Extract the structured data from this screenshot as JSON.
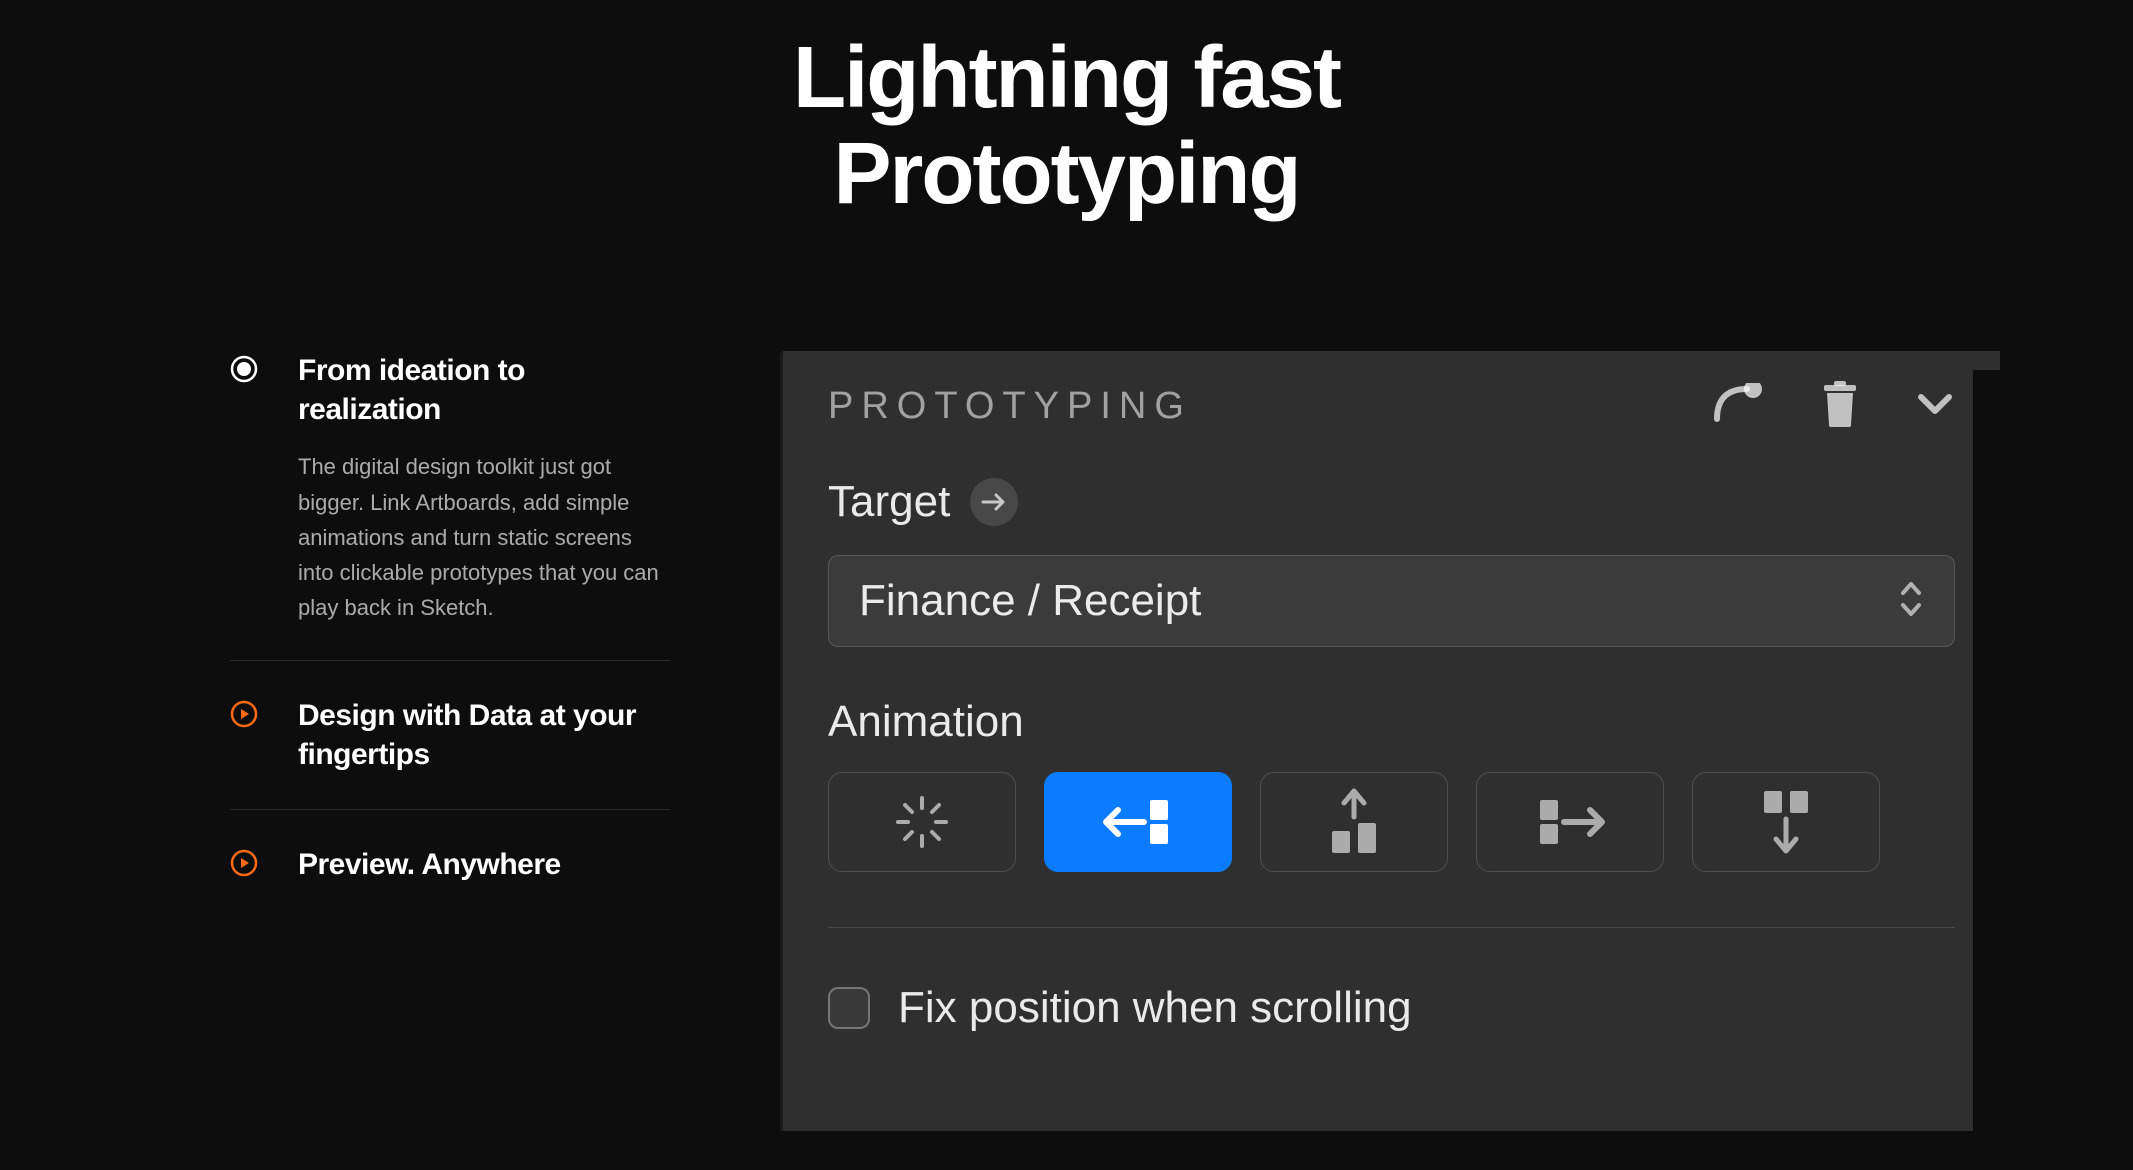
{
  "hero": {
    "line1": "Lightning fast",
    "line2": "Prototyping"
  },
  "sidebar": {
    "items": [
      {
        "title": "From ideation to realization",
        "desc": "The digital design toolkit just got bigger. Link Artboards, add simple animations and turn static screens into clickable prototypes that you can play back in Sketch.",
        "active": true
      },
      {
        "title": "Design with Data at your fingertips",
        "active": false
      },
      {
        "title": "Preview. Anywhere",
        "active": false
      }
    ]
  },
  "panel": {
    "title": "PROTOTYPING",
    "target_label": "Target",
    "target_value": "Finance / Receipt",
    "animation_label": "Animation",
    "animation_options": [
      "none",
      "slide-left",
      "slide-up",
      "slide-right",
      "slide-down"
    ],
    "animation_selected_index": 1,
    "checkbox_label": "Fix position when scrolling",
    "checkbox_checked": false
  },
  "colors": {
    "accent": "#ff6a13",
    "blue": "#0b7cff",
    "bg": "#0d0d0d",
    "panel_bg": "#2f2f2f"
  }
}
